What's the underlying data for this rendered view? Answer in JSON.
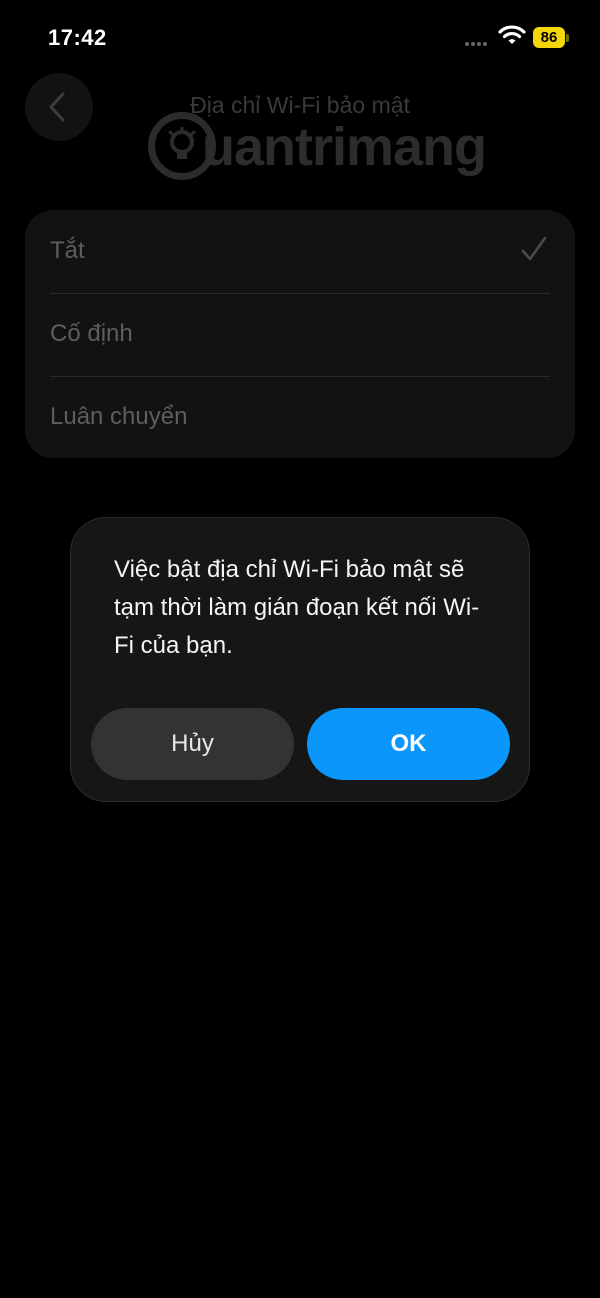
{
  "status_bar": {
    "time": "17:42",
    "battery": "86",
    "battery_color": "#f5d60a",
    "icons": [
      "signal-dots-icon",
      "wifi-icon",
      "battery-icon"
    ]
  },
  "header": {
    "title": "Địa chỉ Wi-Fi bảo mật",
    "back_icon": "chevron-left-icon"
  },
  "watermark": {
    "text": "uantrimang",
    "logo_icon": "lightbulb-icon"
  },
  "options": [
    {
      "label": "Tắt",
      "selected": true
    },
    {
      "label": "Cố định",
      "selected": false
    },
    {
      "label": "Luân chuyển",
      "selected": false
    }
  ],
  "dialog": {
    "message": "Việc bật địa chỉ Wi-Fi bảo mật sẽ tạm thời làm gián đoạn kết nối Wi-Fi của bạn.",
    "cancel_label": "Hủy",
    "ok_label": "OK",
    "accent_color": "#0a96fb"
  }
}
